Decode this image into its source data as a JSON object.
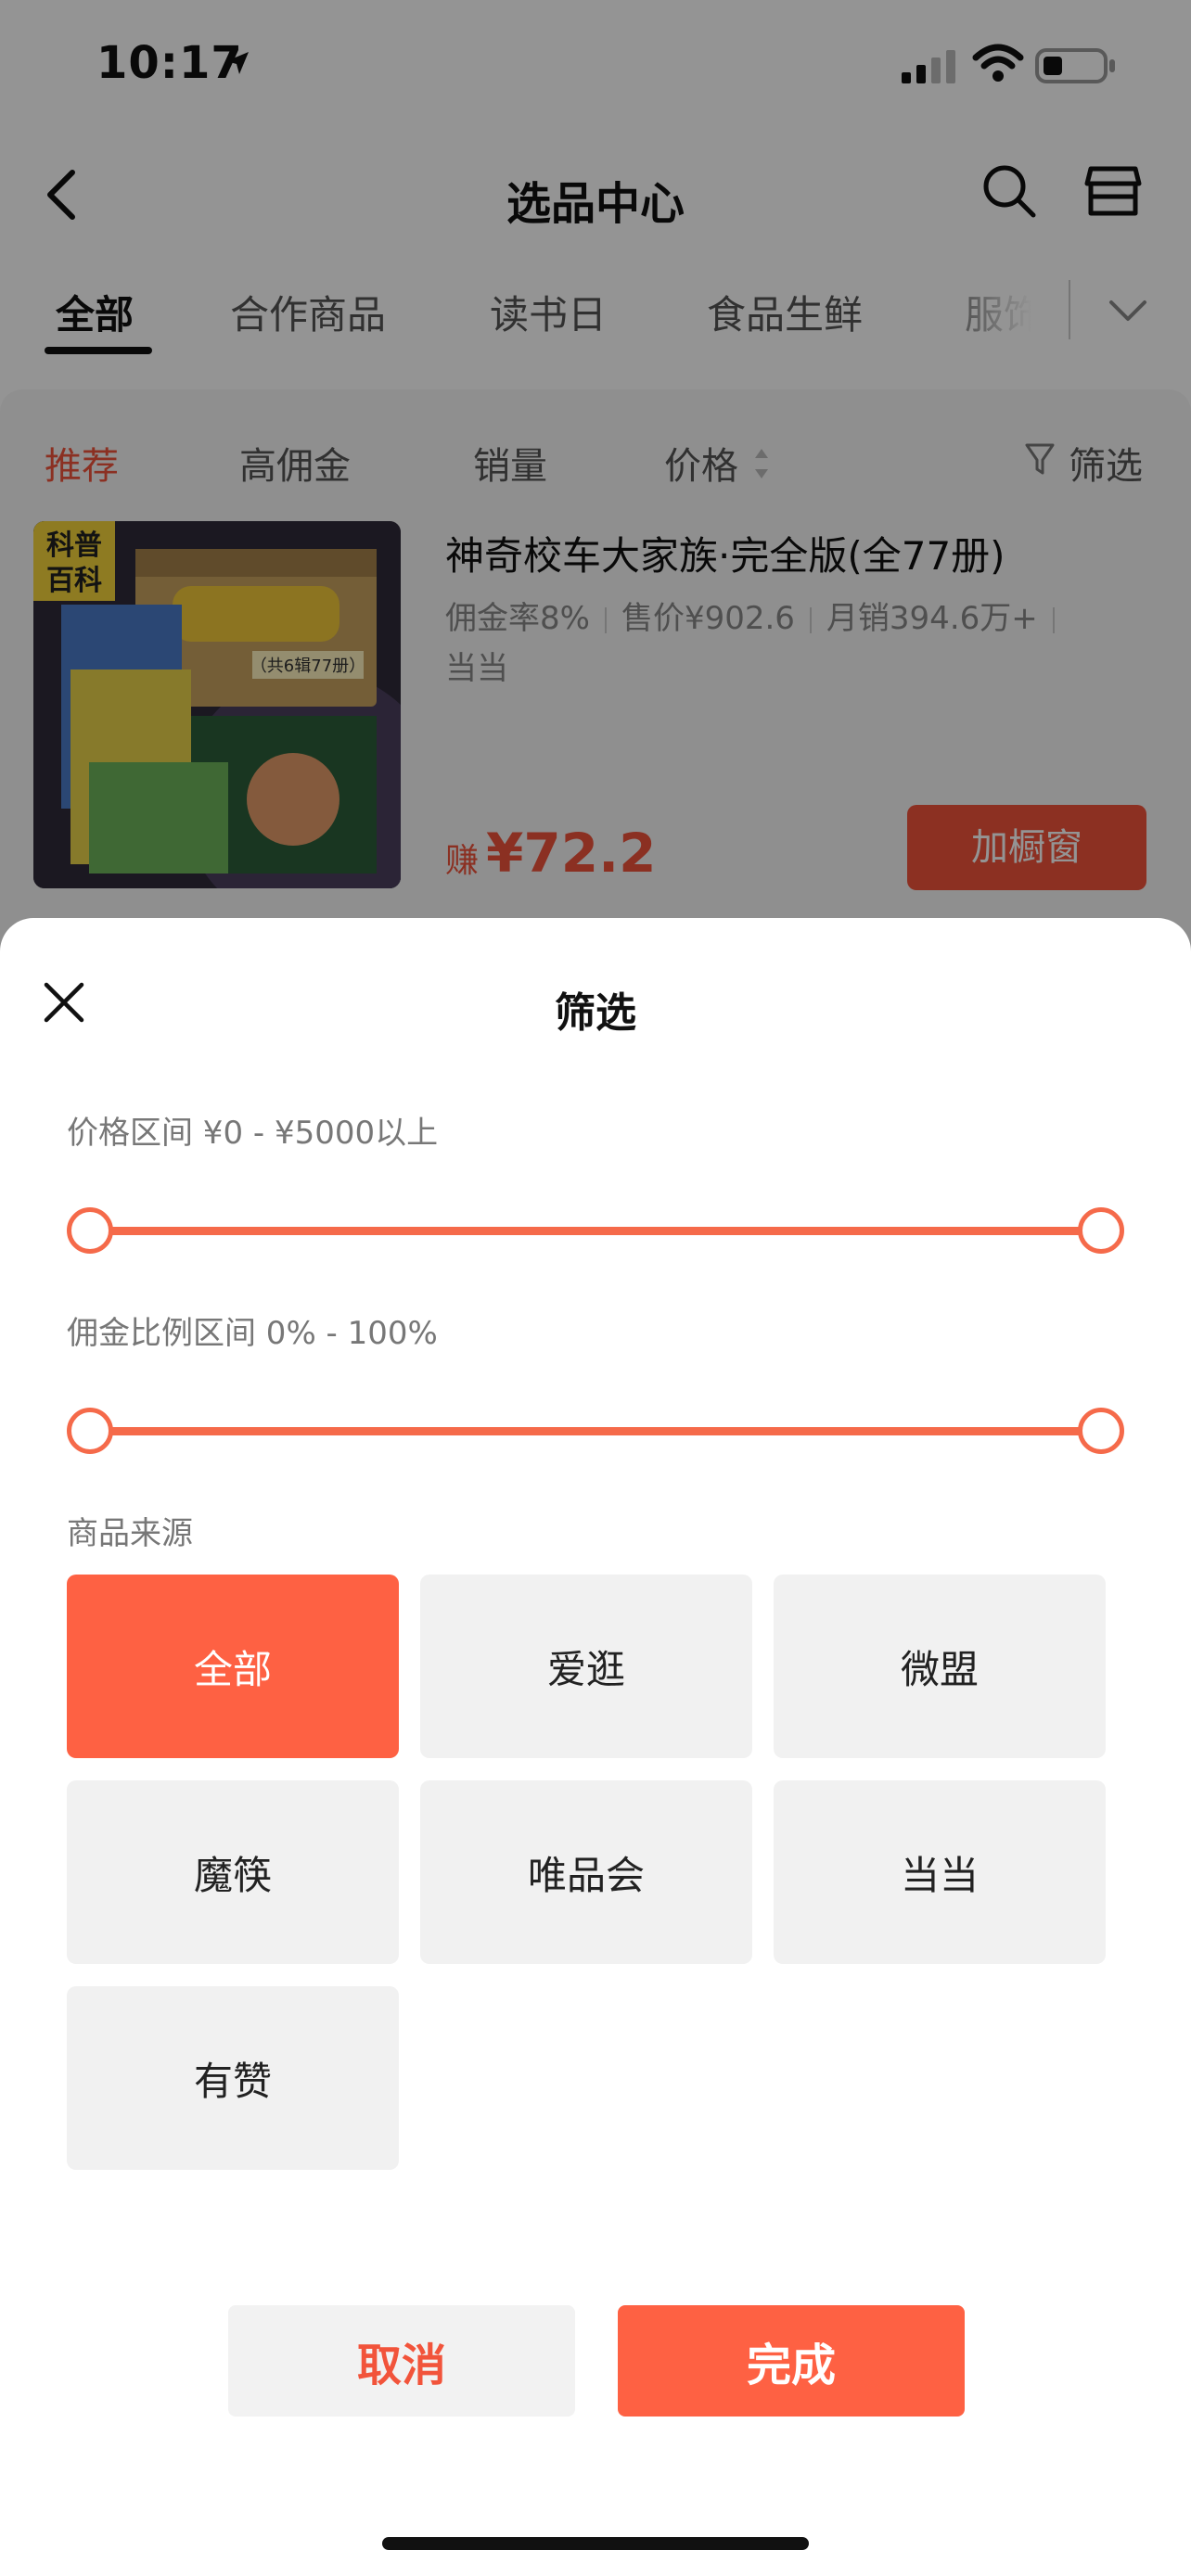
{
  "status_bar": {
    "time": "10:17"
  },
  "nav": {
    "title": "选品中心"
  },
  "category_tabs": [
    "全部",
    "合作商品",
    "读书日",
    "食品生鲜",
    "服饰"
  ],
  "sort_bar": {
    "items": [
      "推荐",
      "高佣金",
      "销量",
      "价格"
    ],
    "filter_label": "筛选"
  },
  "product": {
    "title": "神奇校车大家族·完全版(全77册)",
    "commission": "佣金率8%",
    "price": "售价¥902.6",
    "monthly_sales": "月销394.6万+",
    "source": "当当",
    "earn_label": "赚",
    "earn_value": "¥72.2",
    "add_button": "加橱窗",
    "image_badge_line1": "科普",
    "image_badge_line2": "百科",
    "image_box_note": "（共6辑77册）"
  },
  "filter_sheet": {
    "title": "筛选",
    "price_label": "价格区间 ¥0 - ¥5000以上",
    "price_range": {
      "min": 0,
      "max": 5000
    },
    "commission_label": "佣金比例区间 0% - 100%",
    "commission_range": {
      "min": 0,
      "max": 100
    },
    "source_label": "商品来源",
    "sources": [
      "全部",
      "爱逛",
      "微盟",
      "魔筷",
      "唯品会",
      "当当",
      "有赞"
    ],
    "selected_source": "全部",
    "cancel_label": "取消",
    "done_label": "完成"
  },
  "colors": {
    "accent": "#fe6143",
    "accent_text": "#f2543b",
    "slider": "#f56a4a"
  }
}
